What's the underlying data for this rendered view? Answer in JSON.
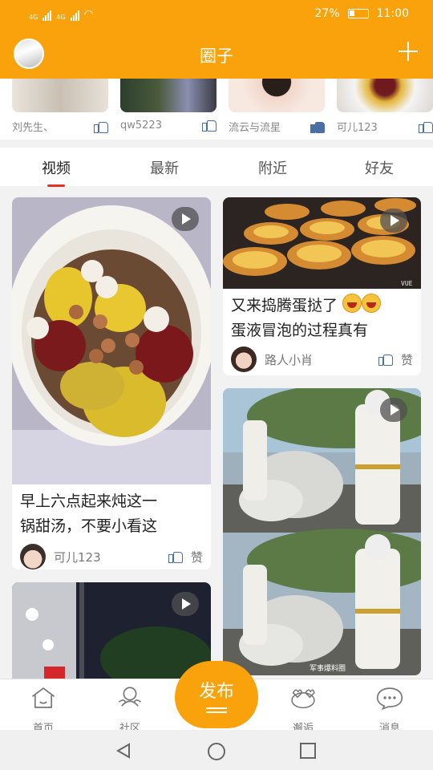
{
  "status_bar": {
    "network_1": "4G",
    "network_2": "4G",
    "battery": "27%",
    "time": "11:00"
  },
  "header": {
    "title": "圈子"
  },
  "stories": [
    {
      "name": "刘先生、",
      "liked": false
    },
    {
      "name": "qw5223",
      "liked": false
    },
    {
      "name": "流云与流星",
      "liked": true
    },
    {
      "name": "可儿123",
      "liked": false
    }
  ],
  "tabs": [
    {
      "label": "视频",
      "active": true
    },
    {
      "label": "最新"
    },
    {
      "label": "附近"
    },
    {
      "label": "好友"
    }
  ],
  "feed": {
    "left": [
      {
        "caption_line1": "早上六点起来炖这一",
        "caption_line2": "锅甜汤，不要小看这",
        "author": "可儿123",
        "like": "赞"
      }
    ],
    "right": [
      {
        "caption_line1": "又来捣腾蛋挞了",
        "caption_line2": "蛋液冒泡的过程真有",
        "author": "路人小肖",
        "like": "赞",
        "watermark": "VUE"
      },
      {
        "watermark": "军事爆料圈"
      }
    ]
  },
  "bottom_nav": {
    "items": [
      {
        "label": "首页"
      },
      {
        "label": "社区"
      },
      {
        "label": "邂逅"
      },
      {
        "label": "消息"
      }
    ],
    "publish": "发布"
  },
  "colors": {
    "accent": "#f9a20b",
    "tab_underline": "#e0342b",
    "like_icon": "#4a6fa5"
  }
}
